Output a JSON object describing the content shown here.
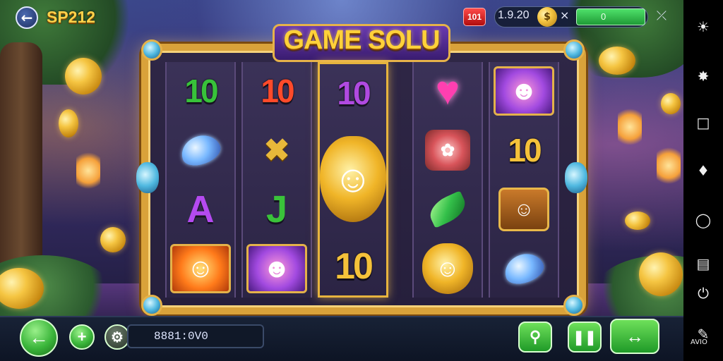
{
  "header": {
    "brand": "SP212",
    "badge": "101",
    "balance": "1̱.20",
    "balance_display": "1.9.20",
    "balance_suffix": "×",
    "meter_value": "0"
  },
  "game": {
    "title": "GAME SOLU",
    "reels": [
      [
        "10",
        "gem-blue",
        "A",
        "portrait-fire"
      ],
      [
        "10",
        "gold-glyph",
        "J",
        "portrait-purple"
      ],
      [
        "10",
        "mask-big",
        "10"
      ],
      [
        "heart",
        "basket",
        "gem-green",
        "mask-small"
      ],
      [
        "portrait-purple",
        "10",
        "chest",
        "gem-blue"
      ]
    ],
    "gold_glyph": "✖",
    "colors": {
      "ten_green": "#38c23a",
      "ten_red": "#ff4a2a",
      "ten_purple_green": "#b04ae0",
      "ten_gold": "#f5c23a",
      "letter_A": "#b44af0",
      "letter_J": "#3ac23a"
    }
  },
  "footer": {
    "bet_value": "8881:0V0",
    "icons": {
      "back": "arrow-left-icon",
      "add": "plus-icon",
      "settings": "gear-icon",
      "search": "search-icon",
      "pause": "pause-icon",
      "swap": "swap-arrows-icon"
    }
  },
  "nav": {
    "caption": "AVIO"
  }
}
